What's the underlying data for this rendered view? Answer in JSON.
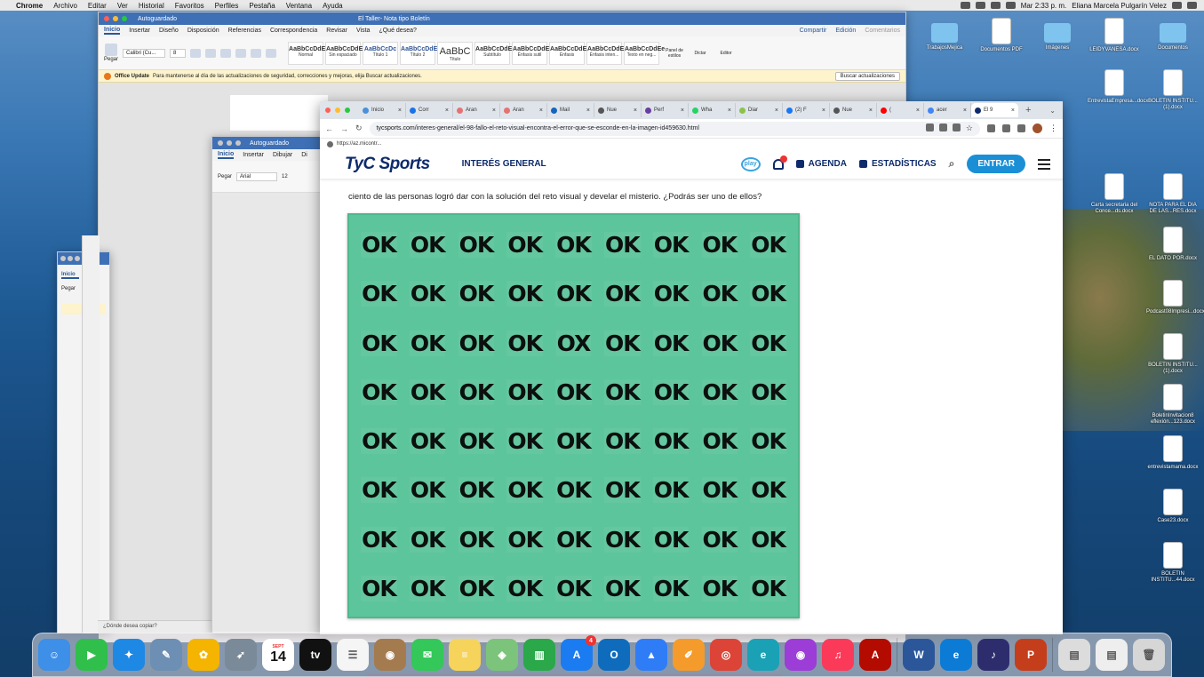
{
  "menubar": {
    "app": "Chrome",
    "items": [
      "Archivo",
      "Editar",
      "Ver",
      "Historial",
      "Favoritos",
      "Perfiles",
      "Pestaña",
      "Ventana",
      "Ayuda"
    ],
    "clock": "Mar 2:33 p. m.",
    "user": "Eliana Marcela Pulgarín Velez"
  },
  "desktop": {
    "icons": [
      {
        "label": "TrabajosMejica",
        "kind": "folder"
      },
      {
        "label": "Documentos PDF",
        "kind": "doc"
      },
      {
        "label": "Imágenes",
        "kind": "folder"
      },
      {
        "label": "LEIDYVANESA.docx",
        "kind": "doc"
      },
      {
        "label": "Documentos",
        "kind": "folder"
      },
      {
        "label": "EntrevistaEmpresa...docx",
        "kind": "doc"
      },
      {
        "label": "BOLETIN INSTITU...(1).docx",
        "kind": "doc"
      },
      {
        "label": "Carta secretaria del Conce...ds.docx",
        "kind": "doc"
      },
      {
        "label": "NOTA PARA EL DIA DE LAS...RES.docx",
        "kind": "doc"
      },
      {
        "label": "EL DATO POR.docx",
        "kind": "doc"
      },
      {
        "label": "Podcast08Impresi...docx",
        "kind": "doc"
      },
      {
        "label": "BOLETIN INSTITU...(1).docx",
        "kind": "doc"
      },
      {
        "label": "BoletinInvitacion8 eflexión...123.docx",
        "kind": "doc"
      },
      {
        "label": "entrevistamama.docx",
        "kind": "doc"
      },
      {
        "label": "Case23.docx",
        "kind": "doc"
      },
      {
        "label": "BOLETIN INSTITU...44.docx",
        "kind": "doc"
      }
    ]
  },
  "word_main": {
    "title": "El Taller- Nota tipo Boletín",
    "autosave": "Autoguardado",
    "tabs": [
      "Inicio",
      "Insertar",
      "Diseño",
      "Disposición",
      "Referencias",
      "Correspondencia",
      "Revisar",
      "Vista"
    ],
    "tell_me": "¿Qué desea?",
    "share": "Compartir",
    "edition": "Edición",
    "comments": "Comentarios",
    "paste": "Pegar",
    "font": "Calibri (Cu...",
    "size": "8",
    "styles": [
      {
        "sample": "AaBbCcDdEe",
        "name": "Normal"
      },
      {
        "sample": "AaBbCcDdEe",
        "name": "Sin espaciado"
      },
      {
        "sample": "AaBbCcDc",
        "name": "Título 1"
      },
      {
        "sample": "AaBbCcDdEe",
        "name": "Título 2"
      },
      {
        "sample": "AaBbC",
        "name": "Título"
      },
      {
        "sample": "AaBbCcDdEe",
        "name": "Subtítulo"
      },
      {
        "sample": "AaBbCcDdEe",
        "name": "Énfasis sutil"
      },
      {
        "sample": "AaBbCcDdEe",
        "name": "Énfasis"
      },
      {
        "sample": "AaBbCcDdEe",
        "name": "Énfasis inten..."
      },
      {
        "sample": "AaBbCcDdEe",
        "name": "Texto en neg..."
      }
    ],
    "styles_pane": "Panel de estilos",
    "dictate": "Dictar",
    "editor": "Editor",
    "update_title": "Office Update",
    "update_msg": "Para mantenerse al día de las actualizaciones de seguridad, correcciones y mejoras, elija Buscar actualizaciones.",
    "update_button": "Buscar actualizaciones"
  },
  "word_second": {
    "autosave": "Autoguardado",
    "tabs": [
      "Inicio",
      "Insertar",
      "Dibujar",
      "Di"
    ],
    "font": "Arial",
    "size": "12",
    "paste": "Pegar"
  },
  "word_third": {
    "tab": "Inicio",
    "paste": "Pegar",
    "status": "¿Dónde desea copiar?"
  },
  "browser": {
    "tabs": [
      {
        "label": "Inicio",
        "color": "#4a90d9"
      },
      {
        "label": "Corr",
        "color": "#1a73e8"
      },
      {
        "label": "Aran",
        "color": "#e57373"
      },
      {
        "label": "Aran",
        "color": "#e57373"
      },
      {
        "label": "Mail",
        "color": "#1565c0"
      },
      {
        "label": "Nue",
        "color": "#555555"
      },
      {
        "label": "Perf",
        "color": "#6a3ea1"
      },
      {
        "label": "Wha",
        "color": "#25d366"
      },
      {
        "label": "Diar",
        "color": "#8bc34a"
      },
      {
        "label": "(2) F",
        "color": "#1877f2"
      },
      {
        "label": "Nue",
        "color": "#555555"
      },
      {
        "label": "(",
        "color": "#ff0000"
      },
      {
        "label": "acer",
        "color": "#4285f4"
      },
      {
        "label": "El 9",
        "color": "#0d2a6b",
        "active": true
      }
    ],
    "url_host": "tycsports.com",
    "url_path": "/interes-general/el-98-fallo-el-reto-visual-encontra-el-error-que-se-esconde-en-la-imagen-id459630.html",
    "bookmark": "https://az.micontr..."
  },
  "site": {
    "logo": "TyC Sports",
    "section": "INTERÉS GENERAL",
    "play": "play",
    "agenda": "AGENDA",
    "stats": "ESTADÍSTICAS",
    "enter": "ENTRAR",
    "lead": "ciento de las personas logró dar con la solución del reto visual y develar el misterio. ¿Podrás ser uno de ellos?",
    "grid": [
      [
        "OK",
        "OK",
        "OK",
        "OK",
        "OK",
        "OK",
        "OK",
        "OK",
        "OK"
      ],
      [
        "OK",
        "OK",
        "OK",
        "OK",
        "OK",
        "OK",
        "OK",
        "OK",
        "OK"
      ],
      [
        "OK",
        "OK",
        "OK",
        "OK",
        "OX",
        "OK",
        "OK",
        "OK",
        "OK"
      ],
      [
        "OK",
        "OK",
        "OK",
        "OK",
        "OK",
        "OK",
        "OK",
        "OK",
        "OK"
      ],
      [
        "OK",
        "OK",
        "OK",
        "OK",
        "OK",
        "OK",
        "OK",
        "OK",
        "OK"
      ],
      [
        "OK",
        "OK",
        "OK",
        "OK",
        "OK",
        "OK",
        "OK",
        "OK",
        "OK"
      ],
      [
        "OK",
        "OK",
        "OK",
        "OK",
        "OK",
        "OK",
        "OK",
        "OK",
        "OK"
      ],
      [
        "OK",
        "OK",
        "OK",
        "OK",
        "OK",
        "OK",
        "OK",
        "OK",
        "OK"
      ]
    ]
  },
  "dock": {
    "calendar_month": "SEPT",
    "calendar_day": "14",
    "appstore_badge": "4",
    "apps": [
      {
        "name": "finder",
        "color": "#3d8fe8",
        "glyph": "☺"
      },
      {
        "name": "facetime",
        "color": "#2fbf4a",
        "glyph": "▶"
      },
      {
        "name": "safari",
        "color": "#1e88e5",
        "glyph": "✦"
      },
      {
        "name": "preview",
        "color": "#6d8fb3",
        "glyph": "✎"
      },
      {
        "name": "photos",
        "color": "#f4b400",
        "glyph": "✿"
      },
      {
        "name": "launchpad",
        "color": "#7b8a99",
        "glyph": "➶"
      },
      {
        "name": "calendar",
        "color": "#ffffff",
        "glyph": ""
      },
      {
        "name": "appletv",
        "color": "#111111",
        "glyph": "tv"
      },
      {
        "name": "reminders",
        "color": "#f5f5f5",
        "glyph": "☰"
      },
      {
        "name": "contacts",
        "color": "#a47b4f",
        "glyph": "◉"
      },
      {
        "name": "messages",
        "color": "#34c759",
        "glyph": "✉"
      },
      {
        "name": "notes",
        "color": "#f6d35b",
        "glyph": "≡"
      },
      {
        "name": "maps",
        "color": "#7cc37c",
        "glyph": "◈"
      },
      {
        "name": "numbers",
        "color": "#2aa84a",
        "glyph": "▥"
      },
      {
        "name": "appstore",
        "color": "#1a7cf0",
        "glyph": "A"
      },
      {
        "name": "outlook",
        "color": "#0f6cbd",
        "glyph": "O"
      },
      {
        "name": "keynote",
        "color": "#2f7df6",
        "glyph": "▲"
      },
      {
        "name": "pages",
        "color": "#f49b2b",
        "glyph": "✐"
      },
      {
        "name": "chrome",
        "color": "#db4437",
        "glyph": "◎"
      },
      {
        "name": "edge-e",
        "color": "#1aa1b5",
        "glyph": "e"
      },
      {
        "name": "podcasts",
        "color": "#9b3dd6",
        "glyph": "◉"
      },
      {
        "name": "music",
        "color": "#fb3a5a",
        "glyph": "♫"
      },
      {
        "name": "acrobat",
        "color": "#b30b00",
        "glyph": "A"
      },
      {
        "name": "word",
        "color": "#2b579a",
        "glyph": "W"
      },
      {
        "name": "edge",
        "color": "#0c7bd6",
        "glyph": "e"
      },
      {
        "name": "audio",
        "color": "#2d2d6e",
        "glyph": "♪"
      },
      {
        "name": "powerpoint",
        "color": "#c43e1c",
        "glyph": "P"
      },
      {
        "name": "downloads",
        "color": "#dcdcdc",
        "glyph": "▤"
      },
      {
        "name": "documents",
        "color": "#eeeeee",
        "glyph": "▤"
      },
      {
        "name": "trash",
        "color": "#d6d6d6",
        "glyph": "🗑"
      }
    ]
  }
}
